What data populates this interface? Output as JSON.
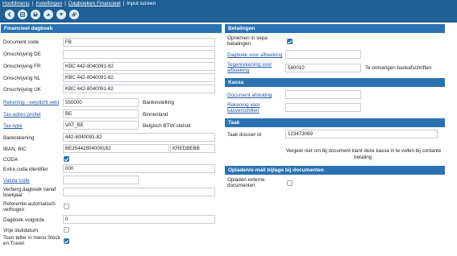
{
  "breadcrumb": [
    "Hoofdmenu",
    "Instellingen",
    "Dagboeken Financieel",
    "Input screen"
  ],
  "toolbar": [
    "back-icon",
    "list-icon",
    "save-icon",
    "up-icon",
    "down-icon",
    "link-icon"
  ],
  "left": {
    "title": "Financieel dagboek",
    "document_code": {
      "label": "Document code",
      "value": "FB"
    },
    "omschrijving_de": {
      "label": "Omschrijving DE",
      "value": ""
    },
    "omschrijving_fr": {
      "label": "Omschrijving FR",
      "value": "KBC 442-8040091-82"
    },
    "omschrijving_nl": {
      "label": "Omschrijving NL",
      "value": "KBC 442-8040091-82"
    },
    "omschrijving_uk": {
      "label": "Omschrijving UK",
      "value": "KBC 442-8040091-82"
    },
    "rekening": {
      "label": "Rekening - verplicht veld",
      "value": "550000",
      "side": "Bankinstelling"
    },
    "tax_adres": {
      "label": "Tax-adres profiel",
      "value": "BE",
      "side": "Binnenland"
    },
    "tax_type": {
      "label": "Tax-type",
      "value": "VAT_BE",
      "side": "Belgisch BTW-stelsel"
    },
    "bankrekening": {
      "label": "Bankrekening",
      "value": "442-8040091-82"
    },
    "iban": {
      "label": "IBAN, BIC",
      "value": "BE25442804009182",
      "bic": "KREDBEBB"
    },
    "coda": {
      "label": "CODA",
      "checked": true
    },
    "extra_coda": {
      "label": "Extra coda identifier",
      "value": "000"
    },
    "valuta": {
      "label": "Valuta code",
      "value": ""
    },
    "verberg": {
      "label": "Verberg dagboek vanaf boekjaar",
      "value": ""
    },
    "referentie": {
      "label": "Referentie automatisch verhogen",
      "checked": false
    },
    "volgorde": {
      "label": "Dagboek volgorde",
      "value": "0"
    },
    "vrije": {
      "label": "Vrije stukdatum",
      "checked": false
    },
    "toon": {
      "label": "Toon teller in menu Stock en Travel",
      "checked": true
    }
  },
  "right": {
    "betalingen": {
      "title": "Betalingen",
      "sepa": {
        "label": "Opnemen in sepa betalingen",
        "checked": true
      },
      "dagboek_afboeking": {
        "label": "Dagboek voor afboeking",
        "value": ""
      },
      "tegenrekening": {
        "label": "Tegenrekening voor afboeking",
        "value": "580010",
        "side": "Te ontvangen bankafschriften"
      }
    },
    "kassa": {
      "title": "Kassa",
      "document_afsluiting": {
        "label": "Document afsluiting",
        "value": ""
      },
      "rekening_kasverschillen": {
        "label": "Rekening voor kasverschillen",
        "value": ""
      }
    },
    "taak": {
      "title": "Taak",
      "dossier": {
        "label": "Taak dossier id",
        "value": "123473069"
      },
      "note": "Vergeet niet om bij document klant deze kassa in te vullen bij contante betaling."
    },
    "opladen": {
      "title": "Opladen/e-mail bijlage bij documenten",
      "externe": {
        "label": "Opladen externe documenten",
        "checked": false
      }
    }
  },
  "colors": {
    "header_bar": "#1e5f95",
    "section_header": "#2b72b2",
    "link": "#2458a8"
  }
}
